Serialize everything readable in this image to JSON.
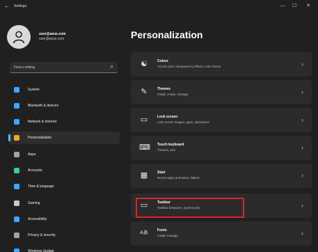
{
  "window": {
    "title": "Settings",
    "back_glyph": "←",
    "minimize_glyph": "—",
    "maximize_glyph": "☐",
    "close_glyph": "✕"
  },
  "user": {
    "name": "user@asus.com",
    "email": "user@asus.com"
  },
  "search": {
    "text": "Find a setting",
    "icon": "search-icon",
    "icon_glyph": "⌕"
  },
  "nav": {
    "active_index": 3,
    "accent_color": "#4cc2ff",
    "items": [
      {
        "label": "System",
        "icon": "monitor-icon",
        "color": "#3ea6ff"
      },
      {
        "label": "Bluetooth & devices",
        "icon": "bluetooth-icon",
        "color": "#3ea6ff"
      },
      {
        "label": "Network & internet",
        "icon": "wifi-icon",
        "color": "#3ea6ff"
      },
      {
        "label": "Personalization",
        "icon": "brush-icon",
        "color": "#f5a623"
      },
      {
        "label": "Apps",
        "icon": "apps-icon",
        "color": "#9aa5b5"
      },
      {
        "label": "Accounts",
        "icon": "person-icon",
        "color": "#3ecf8e"
      },
      {
        "label": "Time & language",
        "icon": "globe-clock-icon",
        "color": "#3ea6ff"
      },
      {
        "label": "Gaming",
        "icon": "gamepad-icon",
        "color": "#c9c9c9"
      },
      {
        "label": "Accessibility",
        "icon": "accessibility-icon",
        "color": "#3ea6ff"
      },
      {
        "label": "Privacy & security",
        "icon": "shield-icon",
        "color": "#9aa5b5"
      },
      {
        "label": "Windows Update",
        "icon": "update-icon",
        "color": "#3ea6ff"
      }
    ]
  },
  "main": {
    "title": "Personalization",
    "chevron_glyph": "›",
    "highlighted_card": "Taskbar",
    "highlight_color": "#e02424",
    "cards": [
      {
        "title": "Colors",
        "description": "Accent color, transparency effects, color theme",
        "icon": "palette-icon",
        "glyph": "☯"
      },
      {
        "title": "Themes",
        "description": "Install, create, manage",
        "icon": "pen-icon",
        "glyph": "✎"
      },
      {
        "title": "Lock screen",
        "description": "Lock screen images, apps, animations",
        "icon": "lock-screen-icon",
        "glyph": "▭"
      },
      {
        "title": "Touch keyboard",
        "description": "Themes, size",
        "icon": "keyboard-icon",
        "glyph": "⌨"
      },
      {
        "title": "Start",
        "description": "Recent apps and items, folders",
        "icon": "start-icon",
        "glyph": "▦"
      },
      {
        "title": "Taskbar",
        "description": "Taskbar behaviors, system pins",
        "icon": "taskbar-icon",
        "glyph": "▭"
      },
      {
        "title": "Fonts",
        "description": "Install, manage",
        "icon": "fonts-icon",
        "glyph": "Aあ"
      }
    ]
  }
}
